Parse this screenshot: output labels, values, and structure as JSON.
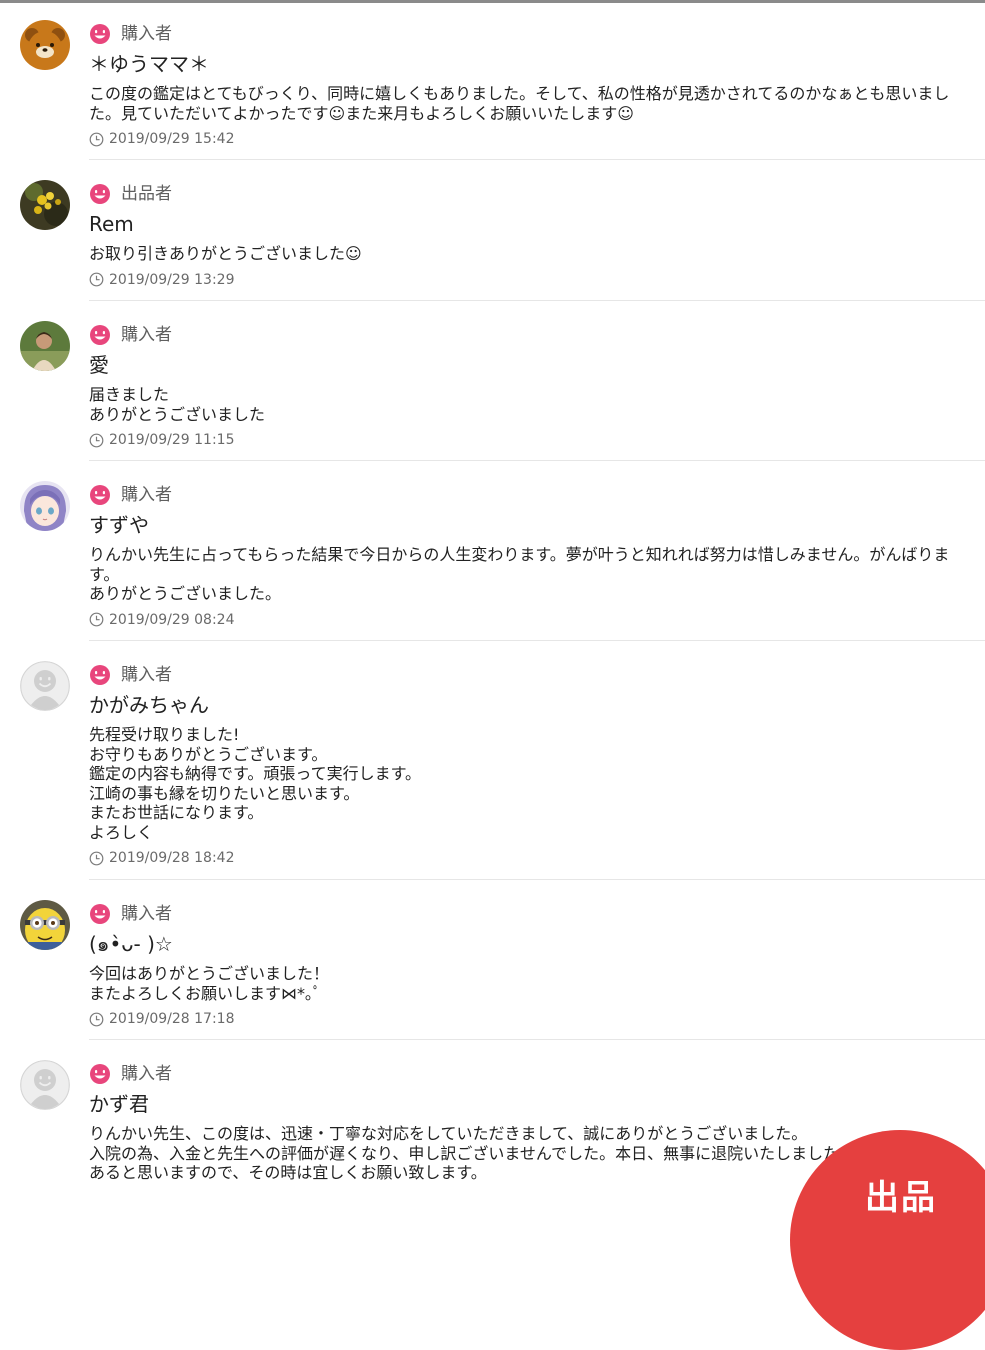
{
  "colors": {
    "role_icon": "#e8467c",
    "text": "#222222",
    "muted": "#6a6a6a",
    "divider": "#e6e6e6",
    "fab": "#e5403f"
  },
  "reviews": [
    {
      "role": "購入者",
      "name": "＊ゆうママ＊",
      "avatar": "bear-avatar",
      "comment": "この度の鑑定はとてもびっくり、同時に嬉しくもありました。そして、私の性格が見透かされてるのかなぁとも思いました。見ていただいてよかったです☺また来月もよろしくお願いいたします☺",
      "date": "2019/09/29 15:42"
    },
    {
      "role": "出品者",
      "name": "Rem",
      "avatar": "flower-photo-avatar",
      "comment": "お取り引きありがとうございました☺",
      "date": "2019/09/29 13:29"
    },
    {
      "role": "購入者",
      "name": "愛",
      "avatar": "person-photo-avatar",
      "comment": "届きました\nありがとうございました",
      "date": "2019/09/29 11:15"
    },
    {
      "role": "購入者",
      "name": "すずや",
      "avatar": "anime-girl-avatar",
      "comment": "りんかい先生に占ってもらった結果で今日からの人生変わります。夢が叶うと知れれば努力は惜しみません。がんばります。\nありがとうございました。",
      "date": "2019/09/29 08:24"
    },
    {
      "role": "購入者",
      "name": "かがみちゃん",
      "avatar": "default-user-avatar",
      "comment": "先程受け取りました!\nお守りもありがとうございます。\n鑑定の内容も納得です。頑張って実行します。\n江崎の事も縁を切りたいと思います。\nまたお世話になります。\nよろしく",
      "date": "2019/09/28 18:42"
    },
    {
      "role": "購入者",
      "name": "(๑•̀ᴗ- )☆",
      "avatar": "minion-avatar",
      "comment": "今回はありがとうございました！\nまたよろしくお願いします⋈*｡ﾟ",
      "date": "2019/09/28 17:18"
    },
    {
      "role": "購入者",
      "name": "かず君",
      "avatar": "default-user-avatar",
      "comment": "りんかい先生、この度は、迅速・丁寧な対応をしていただきまして、誠にありがとうございました。\n入院の為、入金と先生への評価が遅くなり、申し訳ございませんでした。本日、無事に退院いたしました。また、ご縁があると思いますので、その時は宜しくお願い致します。",
      "date": ""
    }
  ],
  "fab": {
    "label": "出品"
  }
}
